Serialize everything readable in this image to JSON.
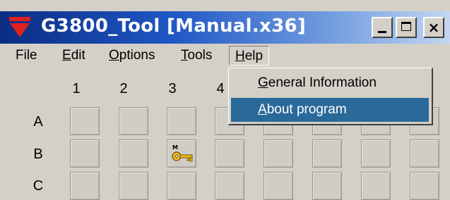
{
  "window": {
    "title": "G3800_Tool [Manual.x36]",
    "title_gradient": [
      "#0b2d83",
      "#c4d6f2"
    ],
    "app_icon": "red-down-triangle-logo",
    "close_glyph": "×"
  },
  "menubar": {
    "file": {
      "accel": "",
      "rest": "File"
    },
    "edit": {
      "accel": "E",
      "rest": "dit"
    },
    "options": {
      "accel": "O",
      "rest": "ptions"
    },
    "tools": {
      "accel": "T",
      "rest": "ools"
    },
    "help": {
      "accel": "H",
      "rest": "elp"
    }
  },
  "help_menu": {
    "items": [
      {
        "accel": "G",
        "rest": "eneral Information"
      },
      {
        "accel": "A",
        "rest": "bout program"
      }
    ],
    "selected_index": 1,
    "highlight_color": "#2a6a9a"
  },
  "grid": {
    "columns": [
      "1",
      "2",
      "3",
      "4"
    ],
    "rows": [
      "A",
      "B",
      "C"
    ],
    "key_cell": {
      "row": "B",
      "column": "3",
      "icon": "key-icon",
      "badge": "M"
    }
  }
}
